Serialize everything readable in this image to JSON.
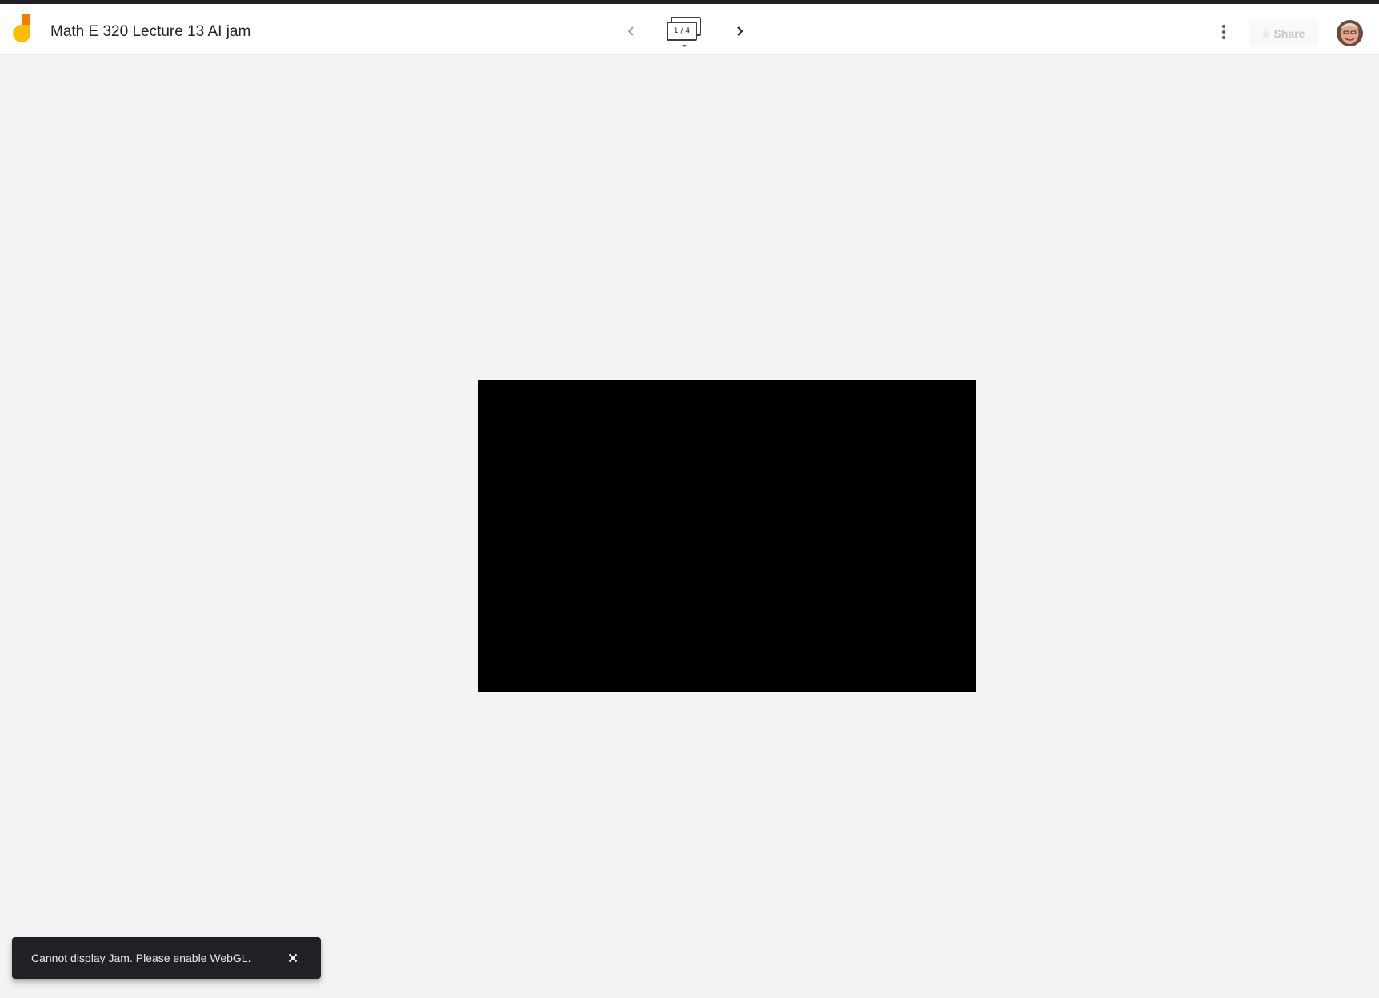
{
  "header": {
    "title": "Math E 320 Lecture 13 AI jam",
    "frame_indicator": "1 / 4",
    "share_label": "Share"
  },
  "icons": {
    "logo": "jamboard-logo-icon",
    "prev": "chevron-left-icon",
    "next": "chevron-right-icon",
    "frames": "frames-stack-icon",
    "more": "more-vert-icon",
    "share": "lock-icon",
    "close": "close-icon"
  },
  "colors": {
    "logo_yellow": "#fbbc04",
    "logo_orange": "#f57c00",
    "background": "#f1f3f4",
    "canvas": "#000000",
    "snackbar": "#202124"
  },
  "snackbar": {
    "message": "Cannot display Jam. Please enable WebGL."
  }
}
